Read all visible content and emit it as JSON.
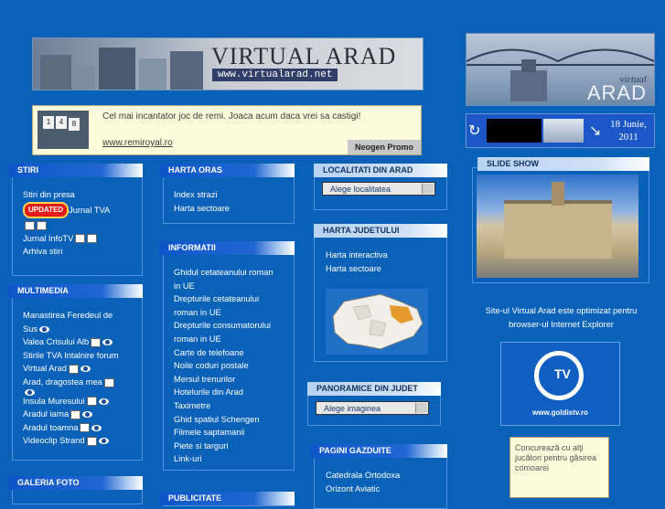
{
  "banner": {
    "title": "VIRTUAL ARAD",
    "url": "www.virtualarad.net"
  },
  "logo_right": {
    "virtual": "virtual",
    "arad": "ARAD"
  },
  "ad": {
    "text": "Cel mai incantator joc de remi. Joaca acum daca vrei sa castigi!",
    "link": "www.remiroyal.ro",
    "promo": "Neogen Promo",
    "tiles": [
      "1",
      "4",
      "8"
    ]
  },
  "weather": {
    "date_line1": "18 Junie,",
    "date_line2": "2011"
  },
  "stiri": {
    "header": "STIRI",
    "items": [
      "Stiri din presa",
      "Jurnal TVA",
      "Jurnal InfoTV",
      "Arhiva stiri"
    ],
    "updated_badge": "UPDATED"
  },
  "multimedia": {
    "header": "MULTIMEDIA",
    "items": [
      "Manastirea Feredeul de",
      "Sus",
      "Valea Crisului Alb",
      "Stirile TVA Intalnire forum",
      "Virtual Arad",
      "Arad, dragostea mea",
      "Insula Muresului",
      "Aradul iarna",
      "Aradul toamna",
      "Videoclip Strand"
    ]
  },
  "galerie": {
    "header": "GALERIA FOTO"
  },
  "harta_oras": {
    "header": "HARTA ORAS",
    "items": [
      "Index strazi",
      "Harta sectoare"
    ]
  },
  "informatii": {
    "header": "INFORMATII",
    "items": [
      "Ghidul cetateanului roman",
      "in UE",
      "Drepturile cetateanului",
      "roman in UE",
      "Drepturile consumatorului",
      "roman in UE",
      "Carte de telefoane",
      "Noile coduri postale",
      "Mersul trenurilor",
      "Hotelurile din Arad",
      "Taximetre",
      "Ghid spatiul Schengen",
      "Filmele saptamanii",
      "Piete si targuri",
      "Link-uri"
    ]
  },
  "publicitate": {
    "header": "PUBLICITATE"
  },
  "localitati": {
    "header": "LOCALITATI DIN ARAD",
    "select": "Alege localitatea"
  },
  "harta_judet": {
    "header": "HARTA JUDETULUI",
    "items": [
      "Harta interactiva",
      "Harta sectoare"
    ]
  },
  "panoramice": {
    "header": "PANORAMICE DIN JUDET",
    "select": "Alege imaginea"
  },
  "gazduite": {
    "header": "PAGINI GAZDUITE",
    "items": [
      "Catedrala Ortodoxa",
      "Orizont Aviatic"
    ]
  },
  "slideshow": {
    "header": "SLIDE SHOW"
  },
  "optimized": {
    "line1": "Site-ul Virtual Arad este optimizat pentru",
    "line2": "browser-ul Internet Explorer"
  },
  "gtv": {
    "url": "www.goldistv.ro"
  },
  "note": {
    "text": "Concurează cu alţi jucători pentru găsirea comoarei"
  }
}
